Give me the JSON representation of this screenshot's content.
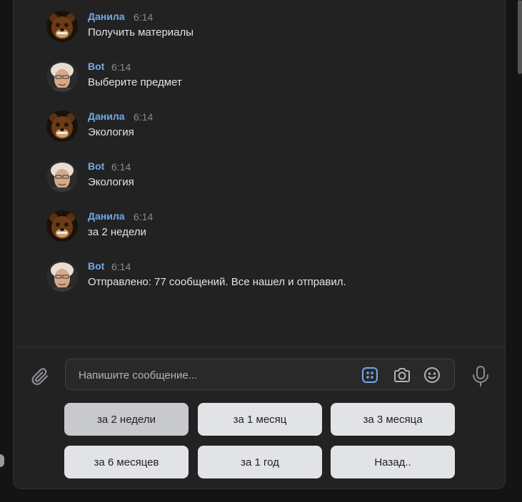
{
  "messages": [
    {
      "author": "Данила",
      "time": "6:14",
      "text": "Получить материалы",
      "avatar": "bear-avatar"
    },
    {
      "author": "Bot",
      "time": "6:14",
      "text": "Выберите предмет",
      "avatar": "person-avatar"
    },
    {
      "author": "Данила",
      "time": "6:14",
      "text": "Экология",
      "avatar": "bear-avatar"
    },
    {
      "author": "Bot",
      "time": "6:14",
      "text": "Экология",
      "avatar": "person-avatar"
    },
    {
      "author": "Данила",
      "time": "6:14",
      "text": "за 2 недели",
      "avatar": "bear-avatar"
    },
    {
      "author": "Bot",
      "time": "6:14",
      "text": "Отправлено: 77 сообщений. Все нашел и отправил.",
      "avatar": "person-avatar"
    }
  ],
  "composer": {
    "placeholder": "Напишите сообщение...",
    "value": ""
  },
  "keyboard": [
    {
      "label": "за 2 недели",
      "active": true
    },
    {
      "label": "за 1 месяц",
      "active": false
    },
    {
      "label": "за 3 месяца",
      "active": false
    },
    {
      "label": "за 6 месяцев",
      "active": false
    },
    {
      "label": "за 1 год",
      "active": false
    },
    {
      "label": "Назад..",
      "active": false
    }
  ],
  "colors": {
    "background": "#222222",
    "author": "#71aaeb",
    "accent": "#71aaeb",
    "button": "#e1e3e6"
  },
  "icons": [
    "attach-icon",
    "keyboard-icon",
    "camera-icon",
    "emoji-icon",
    "microphone-icon"
  ]
}
